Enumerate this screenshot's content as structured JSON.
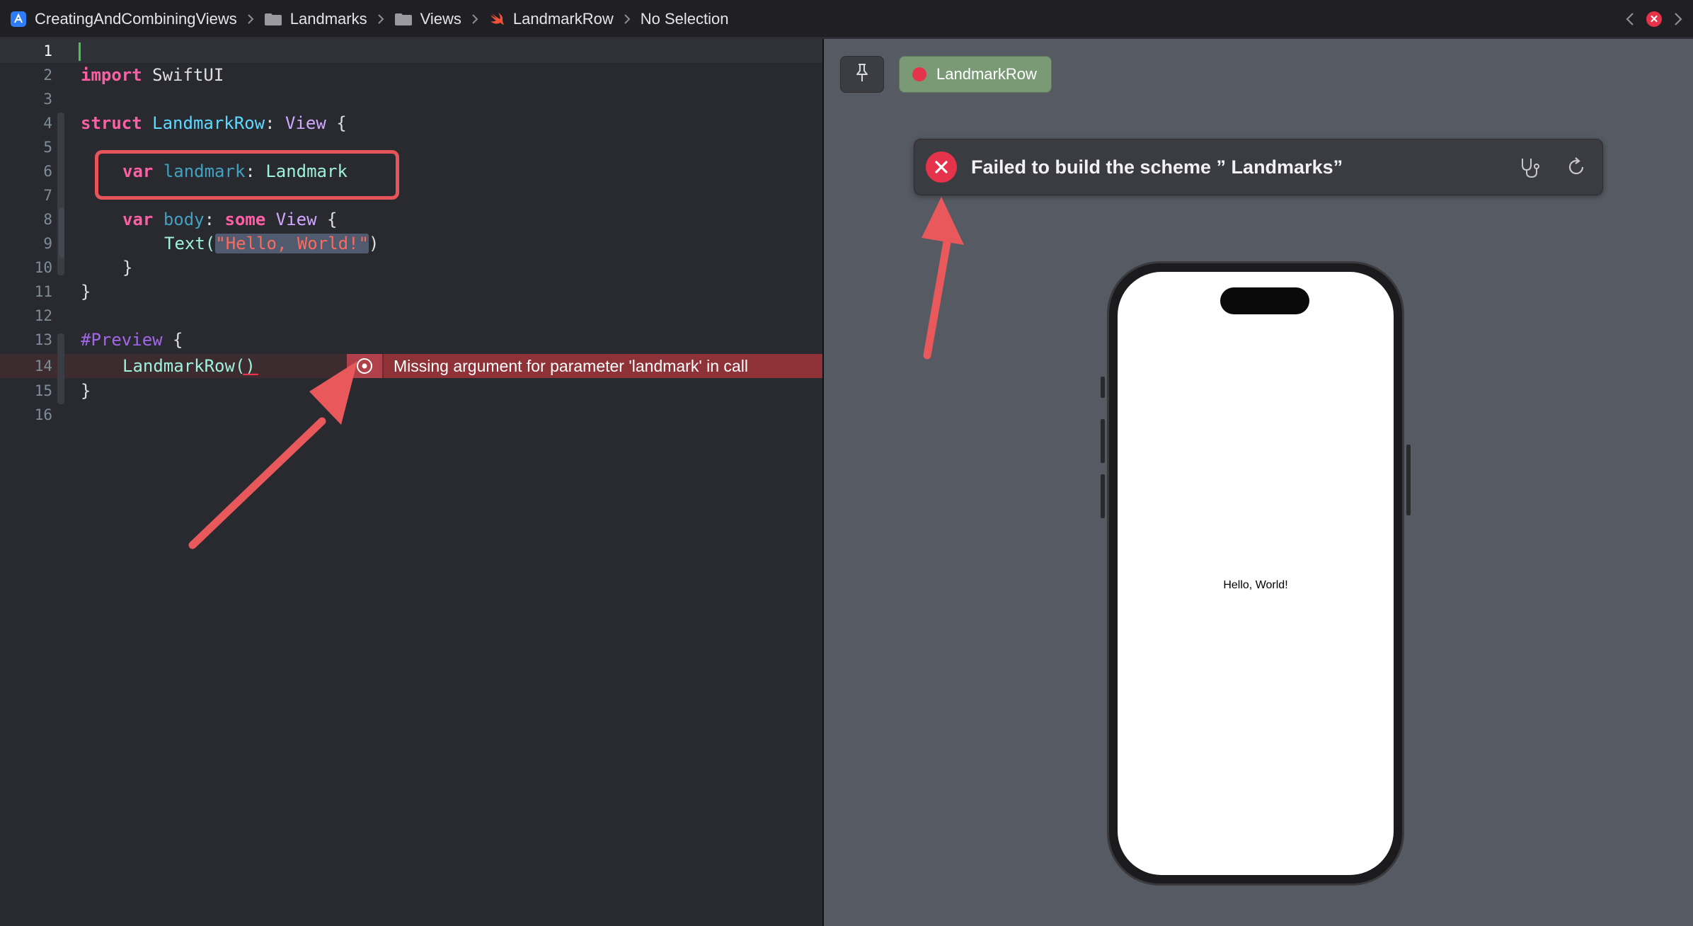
{
  "jumpbar": {
    "crumbs": [
      {
        "label": "CreatingAndCombiningViews",
        "icon": "project-icon"
      },
      {
        "label": "Landmarks",
        "icon": "folder-icon"
      },
      {
        "label": "Views",
        "icon": "folder-icon"
      },
      {
        "label": "LandmarkRow",
        "icon": "swift-file-icon"
      },
      {
        "label": "No Selection",
        "icon": ""
      }
    ],
    "nav": {
      "back": "chevron-left-icon",
      "issues": "error-badge-icon",
      "forward": "chevron-right-icon"
    }
  },
  "editor": {
    "line_numbers": [
      "1",
      "2",
      "3",
      "4",
      "5",
      "6",
      "7",
      "8",
      "9",
      "10",
      "11",
      "12",
      "13",
      "14",
      "15",
      "16"
    ],
    "lines": {
      "l2": {
        "kw": "import",
        "rest": " SwiftUI"
      },
      "l4": {
        "kw": "struct",
        "name": "LandmarkRow",
        "colon": ": ",
        "proto": "View",
        "rest": " {"
      },
      "l6": {
        "kw": "var",
        "name": "landmark",
        "colon": ": ",
        "type": "Landmark"
      },
      "l8": {
        "kw": "var",
        "name": "body",
        "colon": ": ",
        "kw2": "some",
        "type": "View",
        "rest": " {"
      },
      "l9": {
        "call": "Text(",
        "str": "\"Hello, World!\"",
        "close": ")"
      },
      "l10": {
        "text": "}"
      },
      "l11": {
        "text": "}"
      },
      "l13": {
        "macro": "#Preview",
        "rest": " {"
      },
      "l14": {
        "call": "LandmarkRow()"
      },
      "l15": {
        "text": "}"
      }
    },
    "error": {
      "message": "Missing argument for parameter 'landmark' in call",
      "icon": "error-circle-icon"
    }
  },
  "canvas": {
    "pin_icon": "pin-icon",
    "preview_tab": {
      "label": "LandmarkRow",
      "status_color": "#e5334b"
    },
    "banner": {
      "message": "Failed to build the scheme ” Landmarks”",
      "icons": [
        "diagnostics-icon",
        "refresh-icon"
      ]
    },
    "device": {
      "content": "Hello, World!"
    }
  },
  "colors": {
    "accent_error": "#e5334b",
    "annotation": "#e7545a"
  }
}
